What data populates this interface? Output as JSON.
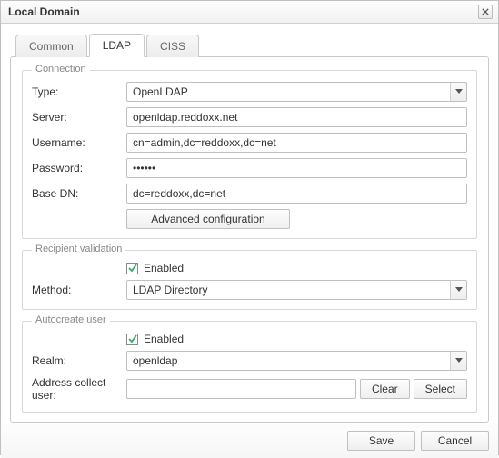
{
  "window": {
    "title": "Local Domain"
  },
  "tabs": {
    "common": "Common",
    "ldap": "LDAP",
    "ciss": "CISS"
  },
  "connection": {
    "legend": "Connection",
    "typeLabel": "Type:",
    "typeValue": "OpenLDAP",
    "serverLabel": "Server:",
    "serverValue": "openldap.reddoxx.net",
    "usernameLabel": "Username:",
    "usernameValue": "cn=admin,dc=reddoxx,dc=net",
    "passwordLabel": "Password:",
    "passwordValue": "••••••",
    "baseDnLabel": "Base DN:",
    "baseDnValue": "dc=reddoxx,dc=net",
    "advancedBtn": "Advanced configuration"
  },
  "recipient": {
    "legend": "Recipient validation",
    "enabledLabel": "Enabled",
    "methodLabel": "Method:",
    "methodValue": "LDAP Directory"
  },
  "autocreate": {
    "legend": "Autocreate user",
    "enabledLabel": "Enabled",
    "realmLabel": "Realm:",
    "realmValue": "openldap",
    "addressLabel": "Address collect user:",
    "addressValue": "",
    "clearBtn": "Clear",
    "selectBtn": "Select"
  },
  "footer": {
    "save": "Save",
    "cancel": "Cancel"
  }
}
